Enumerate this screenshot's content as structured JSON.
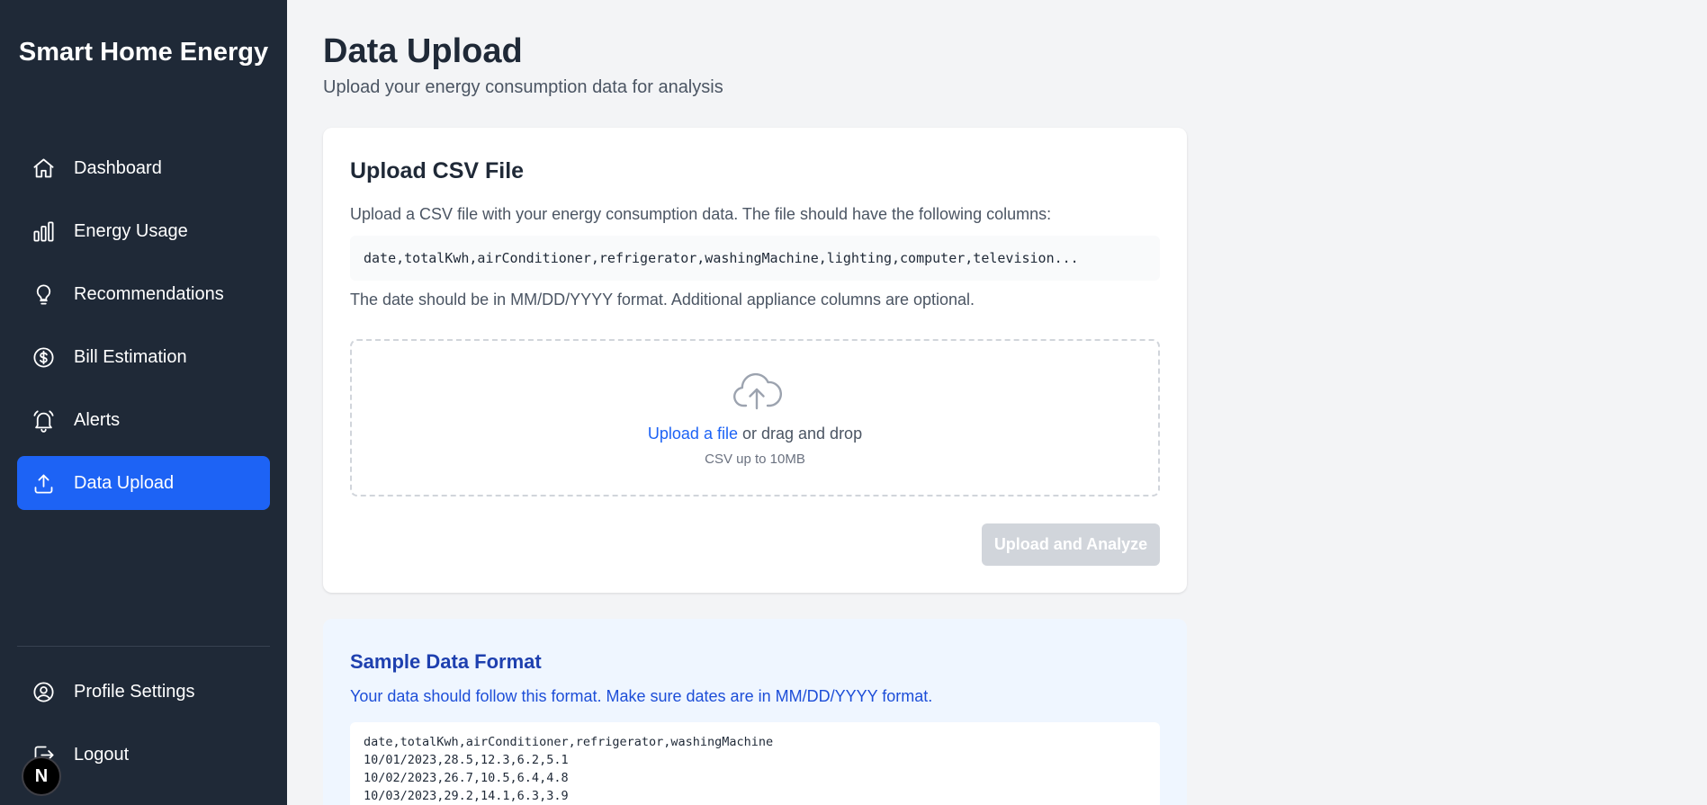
{
  "app": {
    "brand": "Smart Home Energy"
  },
  "sidebar": {
    "items": [
      {
        "label": "Dashboard",
        "icon": "home-icon"
      },
      {
        "label": "Energy Usage",
        "icon": "bar-chart-icon"
      },
      {
        "label": "Recommendations",
        "icon": "lightbulb-icon"
      },
      {
        "label": "Bill Estimation",
        "icon": "dollar-icon"
      },
      {
        "label": "Alerts",
        "icon": "bell-icon"
      },
      {
        "label": "Data Upload",
        "icon": "upload-icon",
        "active": true
      }
    ],
    "bottom": [
      {
        "label": "Profile Settings",
        "icon": "user-circle-icon"
      },
      {
        "label": "Logout",
        "icon": "logout-icon"
      }
    ],
    "badge": "N"
  },
  "header": {
    "title": "Data Upload",
    "subtitle": "Upload your energy consumption data for analysis"
  },
  "upload_card": {
    "title": "Upload CSV File",
    "description": "Upload a CSV file with your energy consumption data. The file should have the following columns:",
    "columns": "date,totalKwh,airConditioner,refrigerator,washingMachine,lighting,computer,television...",
    "note": "The date should be in MM/DD/YYYY format. Additional appliance columns are optional.",
    "dropzone": {
      "link": "Upload a file",
      "text": " or drag and drop",
      "hint": "CSV up to 10MB"
    },
    "submit_label": "Upload and Analyze"
  },
  "sample_card": {
    "title": "Sample Data Format",
    "description": "Your data should follow this format. Make sure dates are in MM/DD/YYYY format.",
    "lines": [
      "date,totalKwh,airConditioner,refrigerator,washingMachine",
      "10/01/2023,28.5,12.3,6.2,5.1",
      "10/02/2023,26.7,10.5,6.4,4.8",
      "10/03/2023,29.2,14.1,6.3,3.9"
    ]
  },
  "colors": {
    "sidebar_bg": "#1f2937",
    "accent": "#1d63f5",
    "page_bg": "#f3f4f6",
    "sample_bg": "#eff6ff"
  }
}
